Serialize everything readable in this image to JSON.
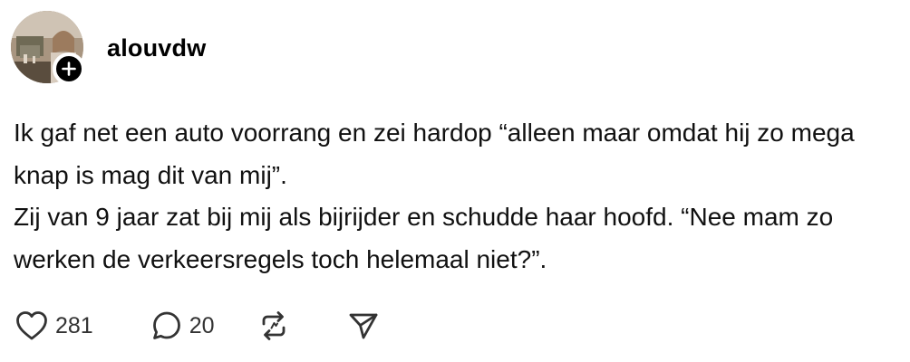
{
  "post": {
    "username": "alouvdw",
    "text_paragraph_1": "Ik gaf net een auto voorrang en zei hardop “alleen maar omdat hij zo mega knap is mag dit van mij”.",
    "text_paragraph_2": "Zij van 9 jaar zat bij mij als bijrijder en schudde haar hoofd. “Nee mam zo werken de verkeersregels toch helemaal niet?”.",
    "likes": "281",
    "replies": "20"
  },
  "icons": {
    "follow": "plus-icon",
    "like": "heart-icon",
    "reply": "comment-bubble-icon",
    "repost": "repost-icon",
    "share": "send-icon"
  },
  "colors": {
    "text": "#000000",
    "secondary": "#333333",
    "badge": "#000000"
  }
}
